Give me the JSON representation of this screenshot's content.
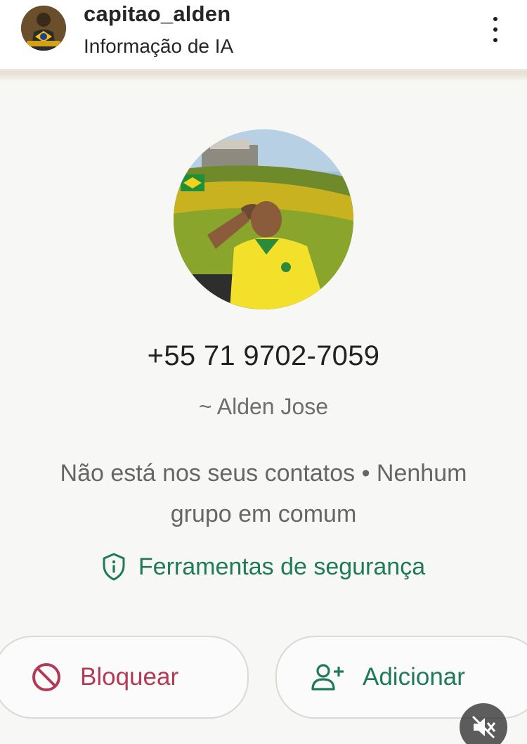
{
  "header": {
    "username": "capitao_alden",
    "subtitle": "Informação de IA",
    "avatar_icon": "profile-avatar",
    "more_icon": "more-vertical-icon"
  },
  "contact": {
    "phone": "+55 71 9702-7059",
    "alias": "~ Alden Jose",
    "info_line1": "Não está nos seus contatos • Nenhum",
    "info_line2": "grupo em comum",
    "security_label": "Ferramentas de segurança",
    "security_icon": "shield-info-icon"
  },
  "actions": {
    "block_label": "Bloquear",
    "block_icon": "block-icon",
    "add_label": "Adicionar",
    "add_icon": "add-user-icon"
  },
  "overlay": {
    "mute_icon": "muted-speaker-icon"
  },
  "colors": {
    "accent_green": "#1f7a5a",
    "block_red": "#b23a55",
    "text_gray": "#666666"
  }
}
